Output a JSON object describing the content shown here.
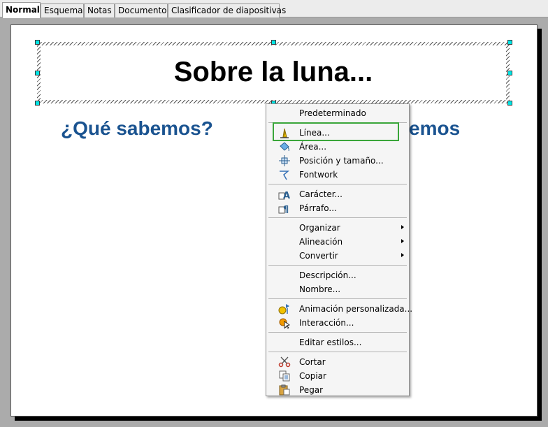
{
  "tabs": [
    "Normal",
    "Esquema",
    "Notas",
    "Documento",
    "Clasificador de diapositivas"
  ],
  "slide": {
    "title": "Sobre la luna...",
    "subtitle_left": "¿Qué sabemos?",
    "subtitle_right_fragment": "emos"
  },
  "context_menu": {
    "items": [
      {
        "label": "Predeterminado",
        "icon": ""
      },
      {
        "label": "Línea...",
        "icon": "line-pen-icon"
      },
      {
        "label": "Área...",
        "icon": "area-bucket-icon"
      },
      {
        "label": "Posición y tamaño...",
        "icon": "position-size-icon"
      },
      {
        "label": "Fontwork",
        "icon": "fontwork-icon"
      },
      {
        "label": "Carácter...",
        "icon": "character-icon"
      },
      {
        "label": "Párrafo...",
        "icon": "paragraph-icon"
      },
      {
        "label": "Organizar",
        "icon": ""
      },
      {
        "label": "Alineación",
        "icon": ""
      },
      {
        "label": "Convertir",
        "icon": ""
      },
      {
        "label": "Descripción...",
        "icon": ""
      },
      {
        "label": "Nombre...",
        "icon": ""
      },
      {
        "label": "Animación personalizada...",
        "icon": "custom-animation-icon"
      },
      {
        "label": "Interacción...",
        "icon": "interaction-icon"
      },
      {
        "label": "Editar estilos...",
        "icon": ""
      },
      {
        "label": "Cortar",
        "icon": "scissors-icon"
      },
      {
        "label": "Copiar",
        "icon": "copy-icon"
      },
      {
        "label": "Pegar",
        "icon": "paste-icon"
      }
    ]
  },
  "colors": {
    "subtitle": "#1a5390",
    "handle": "#00e6e6",
    "highlight": "#3aa63a"
  }
}
